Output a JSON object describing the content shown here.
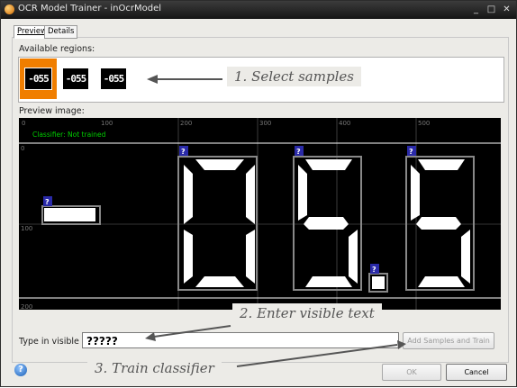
{
  "window": {
    "title": "OCR Model Trainer - inOcrModel",
    "minimize": "_",
    "maximize": "□",
    "close": "✕"
  },
  "tabs": [
    {
      "label": "Preview",
      "active": true
    },
    {
      "label": "Details",
      "active": false
    }
  ],
  "regions": {
    "label": "Available regions:",
    "items": [
      {
        "text": "-055",
        "selected": true
      },
      {
        "text": "-055",
        "selected": false
      },
      {
        "text": "-055",
        "selected": false
      }
    ]
  },
  "preview": {
    "label": "Preview image:",
    "status": "Classifier: Not trained",
    "ruler_x": [
      "0",
      "100",
      "200",
      "300",
      "400",
      "500"
    ],
    "ruler_y": [
      "0",
      "100",
      "200"
    ],
    "unknown_marker": "?"
  },
  "callouts": {
    "select": "1. Select samples",
    "enter": "2. Enter visible text",
    "train": "3. Train classifier"
  },
  "input": {
    "label": "Type in visible text:",
    "value": "?????"
  },
  "buttons": {
    "add": "Add Samples and Train",
    "ok": "OK",
    "cancel": "Cancel"
  },
  "help_icon": "?",
  "colors": {
    "selected_region": "#f07e00",
    "status_text": "#00d000",
    "marker": "#2a2aa8"
  }
}
